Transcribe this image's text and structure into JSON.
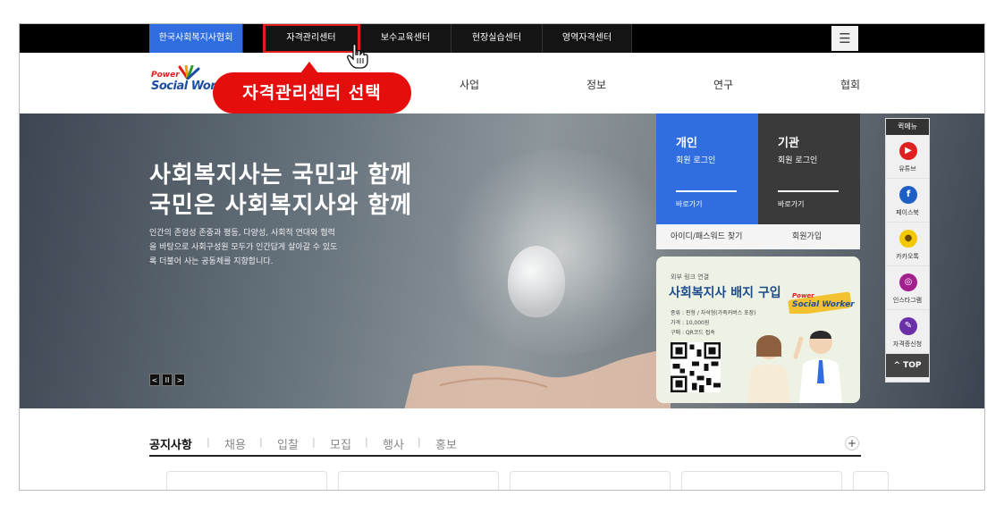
{
  "topbar": {
    "tabs": [
      {
        "label": "한국사회복지사협회",
        "active": true
      },
      {
        "label": "자격관리센터",
        "active": false
      },
      {
        "label": "보수교육센터",
        "active": false
      },
      {
        "label": "현장실습센터",
        "active": false
      },
      {
        "label": "영역자격센터",
        "active": false
      }
    ],
    "menu_icon": "hamburger-icon",
    "menu_glyph": "☰",
    "highlight_color": "#e21b1b"
  },
  "logo": {
    "power": "Power",
    "main": "Social Worker"
  },
  "gnb": [
    "사업",
    "정보",
    "연구",
    "협회"
  ],
  "callout": {
    "text": "자격관리센터 선택",
    "color": "#e60d0d"
  },
  "hero": {
    "title_line1": "사회복지사는 국민과 함께",
    "title_line2": "국민은 사회복지사와 함께",
    "desc_lines": [
      "인간의 존엄성 존중과 평등, 다양성, 사회적 연대와 협력",
      "을 바탕으로 사회구성원 모두가 인간답게 살아갈 수 있도",
      "록 더불어 사는 공동체를 지향합니다."
    ],
    "controls": [
      "<",
      "II",
      ">"
    ]
  },
  "login": {
    "personal": {
      "title": "개인",
      "sub": "회원 로그인",
      "go": "바로가기",
      "color": "#2f6de1"
    },
    "org": {
      "title": "기관",
      "sub": "회원 로그인",
      "go": "바로가기",
      "color": "#3a3a3a"
    },
    "find": "아이디/패스워드 찾기",
    "join": "회원가입"
  },
  "badge": {
    "small": "외부 링크 연결",
    "title": "사회복지사 배지 구입",
    "info": [
      "종류 : 핀형 / 자석형(가죽커버스 포장)",
      "가격 : 10,000원",
      "구매 : QR코드 접속"
    ],
    "logo_power": "Power",
    "logo_main": "Social Worker"
  },
  "quick": {
    "title": "퀵메뉴",
    "items": [
      {
        "label": "유튜브",
        "icon": "youtube-icon",
        "color": "#e02020",
        "glyph": "▶"
      },
      {
        "label": "페이스북",
        "icon": "facebook-icon",
        "color": "#1d5fc4",
        "glyph": "f"
      },
      {
        "label": "카카오톡",
        "icon": "kakaotalk-icon",
        "color": "#f4c800",
        "glyph": "●"
      },
      {
        "label": "인스타그램",
        "icon": "instagram-icon",
        "color": "#a31f8e",
        "glyph": "◎"
      },
      {
        "label": "자격증신청",
        "icon": "certificate-icon",
        "color": "#6b2fa8",
        "glyph": "✎"
      }
    ],
    "top": "^ TOP"
  },
  "notice": {
    "tabs": [
      "공지사항",
      "채용",
      "입찰",
      "모집",
      "행사",
      "홍보"
    ],
    "more": "+"
  }
}
